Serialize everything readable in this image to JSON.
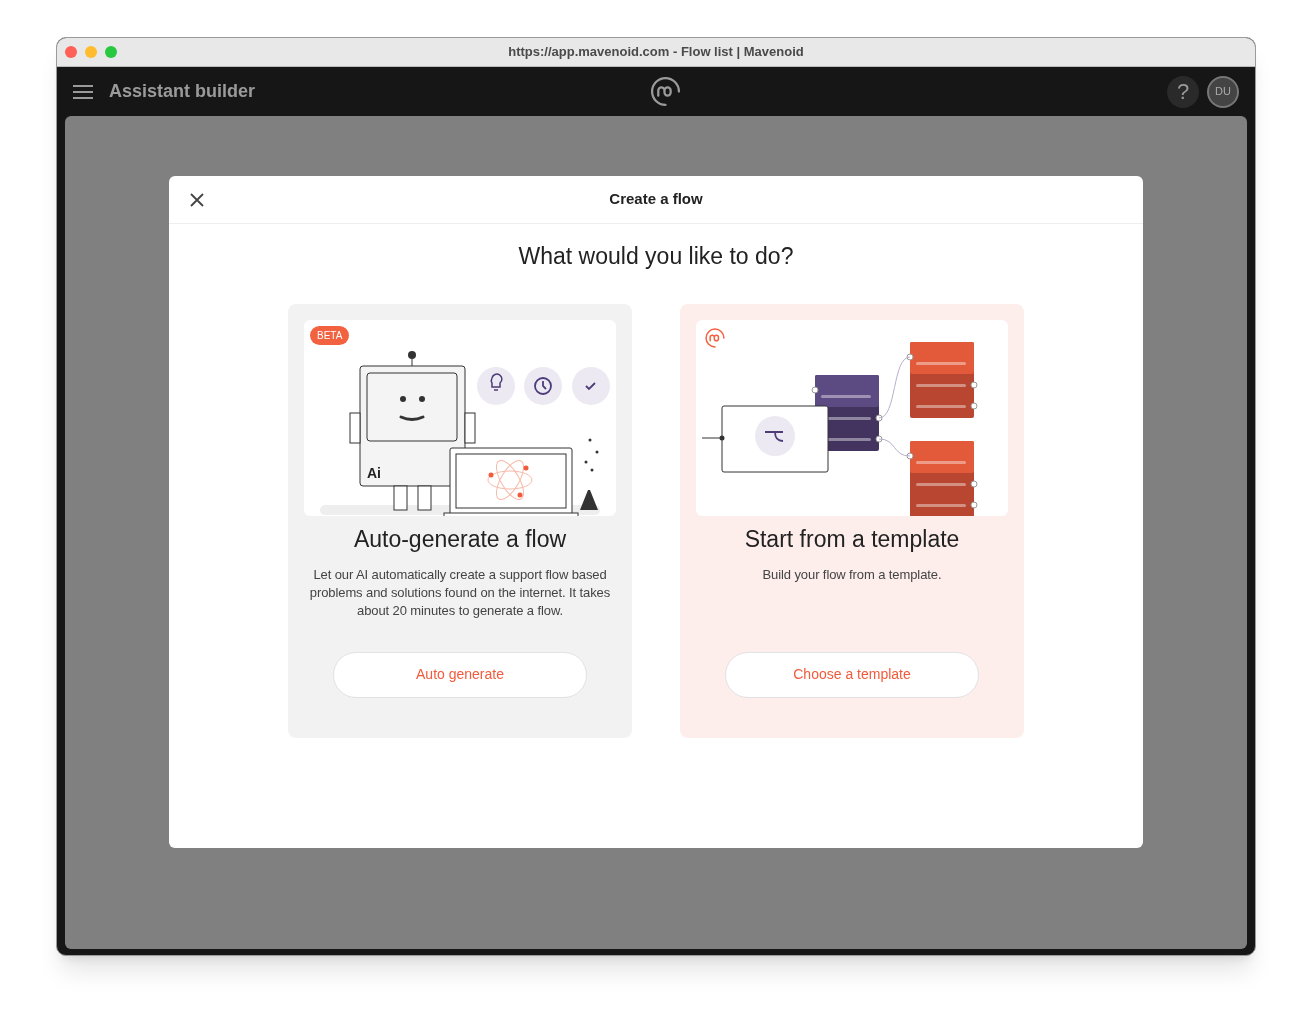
{
  "window": {
    "title": "https://app.mavenoid.com - Flow list | Mavenoid"
  },
  "header": {
    "title": "Assistant builder",
    "help": "?",
    "avatar": "DU"
  },
  "modal": {
    "title": "Create a flow",
    "heading": "What would you like to do?",
    "options": [
      {
        "kind": "auto",
        "badge": "BETA",
        "robot_label": "Ai",
        "title": "Auto-generate a flow",
        "description": "Let our AI automatically create a support flow based problems and solutions found on the internet. It takes about 20 minutes to generate a flow.",
        "button": "Auto generate"
      },
      {
        "kind": "template",
        "title": "Start from a template",
        "description": "Build your flow from a template.",
        "button": "Choose a template"
      }
    ]
  }
}
